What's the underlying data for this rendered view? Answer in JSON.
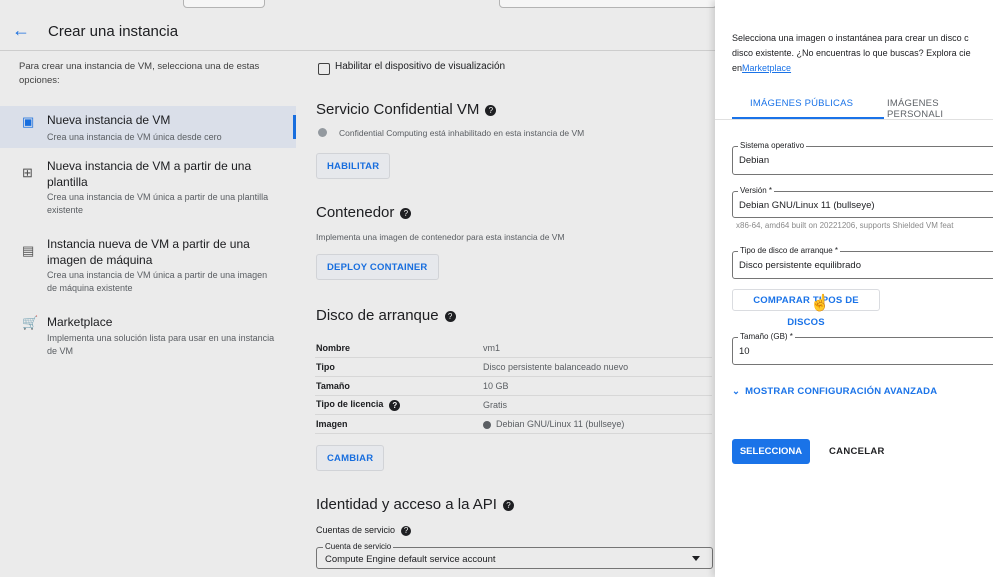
{
  "header": {
    "title": "Crear una instancia"
  },
  "left": {
    "intro": "Para crear una instancia de VM, selecciona una de estas opciones:",
    "options": [
      {
        "title": "Nueva instancia de VM",
        "desc": "Crea una instancia de VM única desde cero",
        "icon": "add-box-icon"
      },
      {
        "title": "Nueva instancia de VM a partir de una plantilla",
        "desc": "Crea una instancia de VM única a partir de una plantilla existente",
        "icon": "template-icon"
      },
      {
        "title": "Instancia nueva de VM a partir de una imagen de máquina",
        "desc": "Crea una instancia de VM única a partir de una imagen de máquina existente",
        "icon": "machine-image-icon"
      },
      {
        "title": "Marketplace",
        "desc": "Implementa una solución lista para usar en una instancia de VM",
        "icon": "marketplace-cart-icon"
      }
    ]
  },
  "main": {
    "display_device_label": "Habilitar el dispositivo de visualización",
    "confidential": {
      "title": "Servicio Confidential VM",
      "note": "Confidential Computing está inhabilitado en esta instancia de VM",
      "button": "HABILITAR"
    },
    "container": {
      "title": "Contenedor",
      "desc": "Implementa una imagen de contenedor para esta instancia de VM",
      "button": "DEPLOY CONTAINER"
    },
    "boot_disk": {
      "title": "Disco de arranque",
      "rows": [
        {
          "k": "Nombre",
          "v": "vm1"
        },
        {
          "k": "Tipo",
          "v": "Disco persistente balanceado nuevo"
        },
        {
          "k": "Tamaño",
          "v": "10 GB"
        },
        {
          "k": "Tipo de licencia",
          "v": "Gratis"
        },
        {
          "k": "Imagen",
          "v": "Debian GNU/Linux 11 (bullseye)"
        }
      ],
      "button": "CAMBIAR"
    },
    "identity": {
      "title": "Identidad y acceso a la API",
      "service_accounts": "Cuentas de servicio",
      "field_label": "Cuenta de servicio",
      "field_value": "Compute Engine default service account"
    }
  },
  "panel": {
    "desc_line1": "Selecciona una imagen o instantánea para crear un disco c",
    "desc_line2": "disco existente. ¿No encuentras lo que buscas? Explora cie",
    "desc_prefix": "en",
    "desc_link": "Marketplace",
    "tabs": [
      "IMÁGENES PÚBLICAS",
      "IMÁGENES PERSONALI"
    ],
    "os_label": "Sistema operativo",
    "os_value": "Debian",
    "version_label": "Versión *",
    "version_value": "Debian GNU/Linux 11 (bullseye)",
    "version_hint": "x86-64, amd64 built on 20221206, supports Shielded VM feat",
    "disk_type_label": "Tipo de disco de arranque *",
    "disk_type_value": "Disco persistente equilibrado",
    "compare_button": "COMPARAR TIPOS DE DISCOS",
    "size_label": "Tamaño (GB) *",
    "size_value": "10",
    "advanced": "MOSTRAR CONFIGURACIÓN AVANZADA",
    "select_button": "SELECCIONA",
    "cancel_button": "CANCELAR"
  }
}
